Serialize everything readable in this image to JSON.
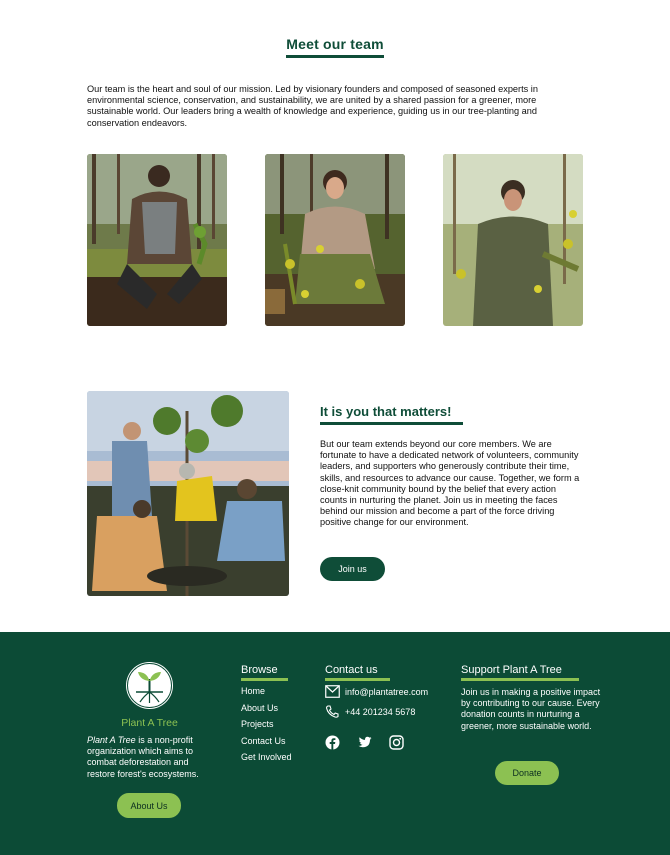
{
  "team": {
    "title": "Meet our team",
    "intro": "Our team is the heart and soul of our mission. Led by visionary founders and composed of seasoned experts in environmental science, conservation, and sustainability, we are united by a shared passion for a greener, more sustainable world. Our leaders bring a wealth of knowledge and experience, guiding us in our tree-planting and conservation endeavors.",
    "photos": [
      "man-planting-sapling-photo",
      "woman-planting-tree-photo",
      "man-inspecting-branch-photo"
    ]
  },
  "matters": {
    "title": "It is you that matters!",
    "text": "But our team extends beyond our core members. We are fortunate to have a dedicated network of volunteers, community leaders, and supporters who generously contribute their time, skills, and resources to advance our cause. Together, we form a close-knit community bound by the belief that every action counts in nurturing the planet. Join us in meeting the faces behind our mission and become a part of the force driving positive change for our environment.",
    "join_label": "Join us"
  },
  "footer": {
    "brand_name": "Plant A Tree",
    "brand_desc_italic": "Plant A Tree",
    "brand_desc_rest": " is a non-profit organization which aims to combat deforestation and restore forest's ecosystems.",
    "about_label": "About Us",
    "browse_title": "Browse",
    "browse_links": [
      "Home",
      "About Us",
      "Projects",
      "Contact Us",
      "Get Involved"
    ],
    "contact_title": "Contact us",
    "email": "info@plantatree.com",
    "phone": "+44 201234 5678",
    "social_icons": [
      "facebook-icon",
      "twitter-icon",
      "instagram-icon"
    ],
    "support_title": "Support Plant A Tree",
    "support_text": "Join us in making a positive impact by contributing to our cause. Every donation counts in nurturing a greener, more sustainable world.",
    "donate_label": "Donate"
  },
  "colors": {
    "primary": "#0f4d38",
    "footer_bg": "#0c4b36",
    "accent": "#8cc152"
  }
}
